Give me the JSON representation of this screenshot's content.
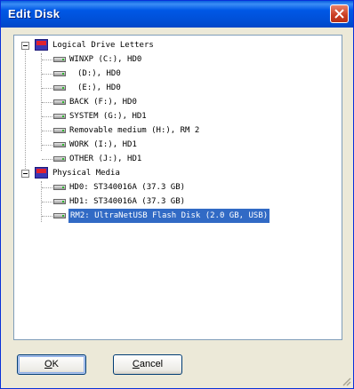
{
  "window": {
    "title": "Edit Disk"
  },
  "tree": {
    "group_logical": "Logical Drive Letters",
    "logical_items": [
      "WINXP (C:), HD0",
      "(D:), HD0",
      "(E:), HD0",
      "BACK (F:), HD0",
      "SYSTEM (G:), HD1",
      "Removable medium (H:), RM 2",
      "WORK (I:), HD1",
      "OTHER (J:), HD1"
    ],
    "group_physical": "Physical Media",
    "physical_items": [
      "HD0: ST340016A (37.3 GB)",
      "HD1: ST340016A (37.3 GB)",
      "RM2: UltraNetUSB Flash Disk (2.0 GB, USB)"
    ],
    "selected_item": "RM2: UltraNetUSB Flash Disk (2.0 GB, USB)"
  },
  "buttons": {
    "ok_accel": "O",
    "ok_rest": "K",
    "cancel_pre": "",
    "cancel_accel": "C",
    "cancel_rest": "ancel"
  },
  "icons": {
    "close": "close-icon",
    "group": "hex-editor-icon",
    "drive": "hard-drive-icon",
    "removable": "removable-drive-icon"
  },
  "colors": {
    "titlebar": "#0058e6",
    "selection": "#316ac5",
    "dialog_bg": "#ece9d8"
  }
}
